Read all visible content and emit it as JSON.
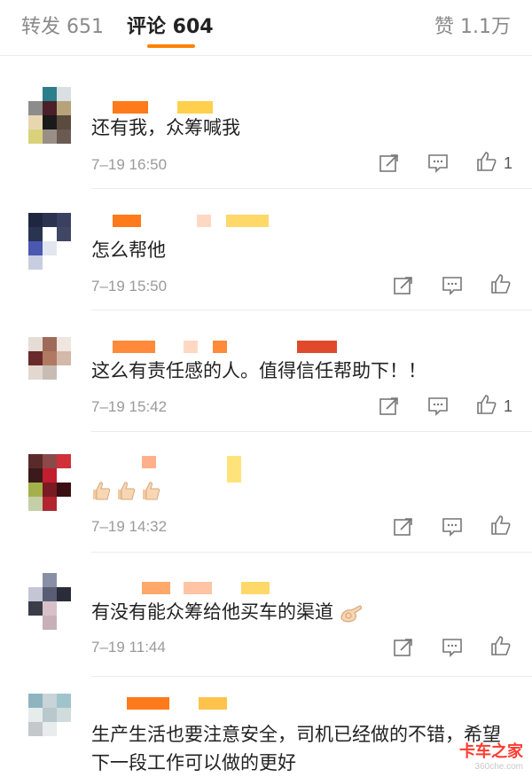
{
  "tabs": {
    "repost": "转发 651",
    "comments": "评论 604",
    "likes": "赞 1.1万"
  },
  "colors": {
    "accent": "#ff8200",
    "time": "#9a9a9a",
    "watermark": "#ff3b2f"
  },
  "comments": [
    {
      "text": "还有我，众筹喊我",
      "time": "7–19 16:50",
      "likes": "1"
    },
    {
      "text": "怎么帮他",
      "time": "7–19 15:50",
      "likes": ""
    },
    {
      "text": "这么有责任感的人。值得信任帮助下！！",
      "time": "7–19 15:42",
      "likes": "1"
    },
    {
      "text": "",
      "emoji": [
        "thumbs-up",
        "thumbs-up",
        "thumbs-up"
      ],
      "time": "7–19 14:32",
      "likes": ""
    },
    {
      "text": "有没有能众筹给他买车的渠道",
      "emoji": [
        "ok-hand"
      ],
      "time": "7–19 11:44",
      "likes": ""
    },
    {
      "text": "生产生活也要注意安全，司机已经做的不错，希望下一段工作可以做的更好",
      "time": "",
      "likes": ""
    }
  ],
  "icons": [
    "repost-icon",
    "comment-icon",
    "like-icon"
  ],
  "watermark": {
    "main": "卡车之家",
    "sub": "360che.com"
  }
}
